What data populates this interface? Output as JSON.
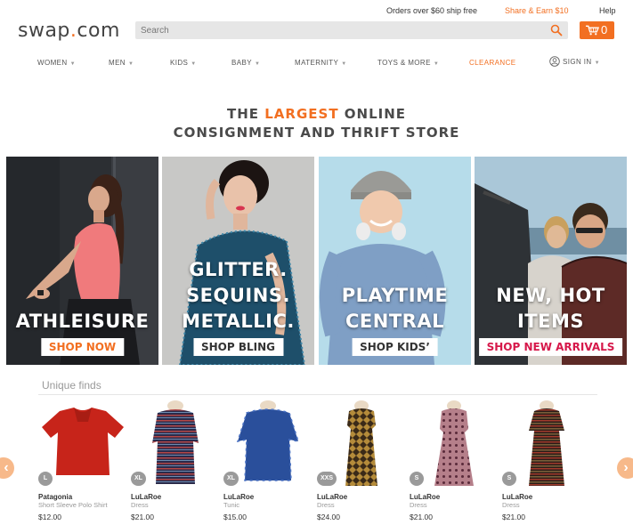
{
  "topbar": {
    "ship_text": "Orders over $60 ship free",
    "share_text": "Share & Earn $10",
    "help_text": "Help"
  },
  "header": {
    "logo_left": "swap",
    "logo_dot": ".",
    "logo_right": "com",
    "search_placeholder": "Search",
    "cart_count": "0",
    "accent_color": "#f26f21"
  },
  "nav": {
    "items": [
      {
        "label": "WOMEN"
      },
      {
        "label": "MEN"
      },
      {
        "label": "KIDS"
      },
      {
        "label": "BABY"
      },
      {
        "label": "MATERNITY"
      },
      {
        "label": "TOYS & MORE"
      },
      {
        "label": "CLEARANCE"
      },
      {
        "label": "SIGN IN"
      }
    ]
  },
  "headline": {
    "part1": "THE ",
    "highlight": "LARGEST",
    "part2": " ONLINE",
    "line2": "CONSIGNMENT AND THRIFT STORE"
  },
  "banners": [
    {
      "title_lines": [
        "ATHLEISURE"
      ],
      "cta": "SHOP NOW"
    },
    {
      "title_lines": [
        "GLITTER.",
        "SEQUINS.",
        "METALLIC."
      ],
      "cta": "SHOP BLING"
    },
    {
      "title_lines": [
        "PLAYTIME",
        "CENTRAL"
      ],
      "cta": "SHOP KIDS’"
    },
    {
      "title_lines": [
        "NEW, HOT",
        "ITEMS"
      ],
      "cta": "SHOP NEW ARRIVALS"
    }
  ],
  "unique_finds": {
    "title": "Unique finds",
    "products": [
      {
        "size": "L",
        "brand": "Patagonia",
        "type": "Short Sleeve Polo Shirt",
        "price": "$12.00"
      },
      {
        "size": "XL",
        "brand": "LuLaRoe",
        "type": "Dress",
        "price": "$21.00"
      },
      {
        "size": "XL",
        "brand": "LuLaRoe",
        "type": "Tunic",
        "price": "$15.00"
      },
      {
        "size": "XXS",
        "brand": "LuLaRoe",
        "type": "Dress",
        "price": "$24.00"
      },
      {
        "size": "S",
        "brand": "LuLaRoe",
        "type": "Dress",
        "price": "$21.00"
      },
      {
        "size": "S",
        "brand": "LuLaRoe",
        "type": "Dress",
        "price": "$21.00"
      }
    ],
    "prev_icon": "chevron-left-icon",
    "next_icon": "chevron-right-icon"
  }
}
